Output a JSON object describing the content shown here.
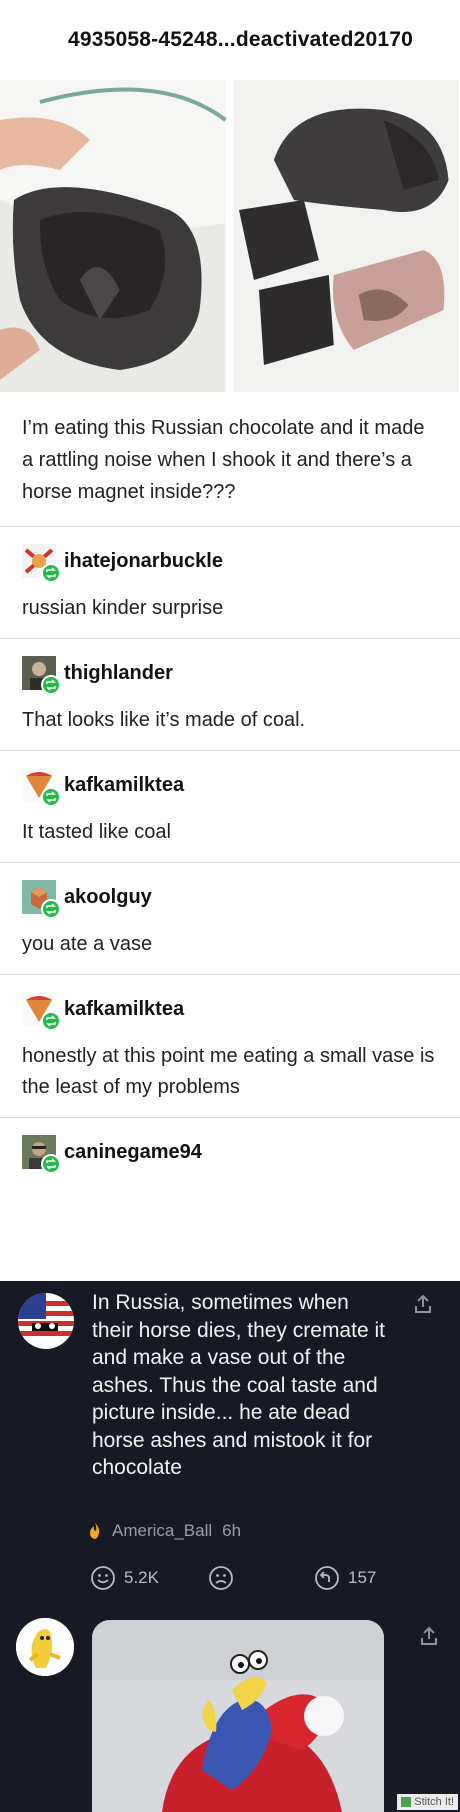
{
  "post": {
    "author": "4935058-45248...deactivated20170",
    "caption": "I’m eating this Russian chocolate and it made a rattling noise when I shook it and there’s a horse magnet inside???"
  },
  "replies": [
    {
      "user": "ihatejonarbuckle",
      "text": "russian kinder surprise"
    },
    {
      "user": "thighlander",
      "text": "That looks like it’s made of coal."
    },
    {
      "user": "kafkamilktea",
      "text": "It tasted like coal"
    },
    {
      "user": "akoolguy",
      "text": "you ate a vase"
    },
    {
      "user": "kafkamilktea",
      "text": "honestly at this point me eating a small vase is the least of my problems"
    },
    {
      "user": "caninegame94",
      "text": ""
    }
  ],
  "comment": {
    "text": "In Russia, sometimes when their horse dies, they cremate it and make a vase out of the ashes. Thus the coal taste and picture inside... he ate dead horse ashes and mistook it for chocolate",
    "author": "America_Ball",
    "time": "6h",
    "upvotes": "5.2K",
    "replies": "157"
  },
  "watermark": "Stitch It!",
  "colors": {
    "reblog_green": "#27b84a",
    "dark_bg": "#171925",
    "muted": "#9a9ca6",
    "fire": "#f5a623"
  }
}
